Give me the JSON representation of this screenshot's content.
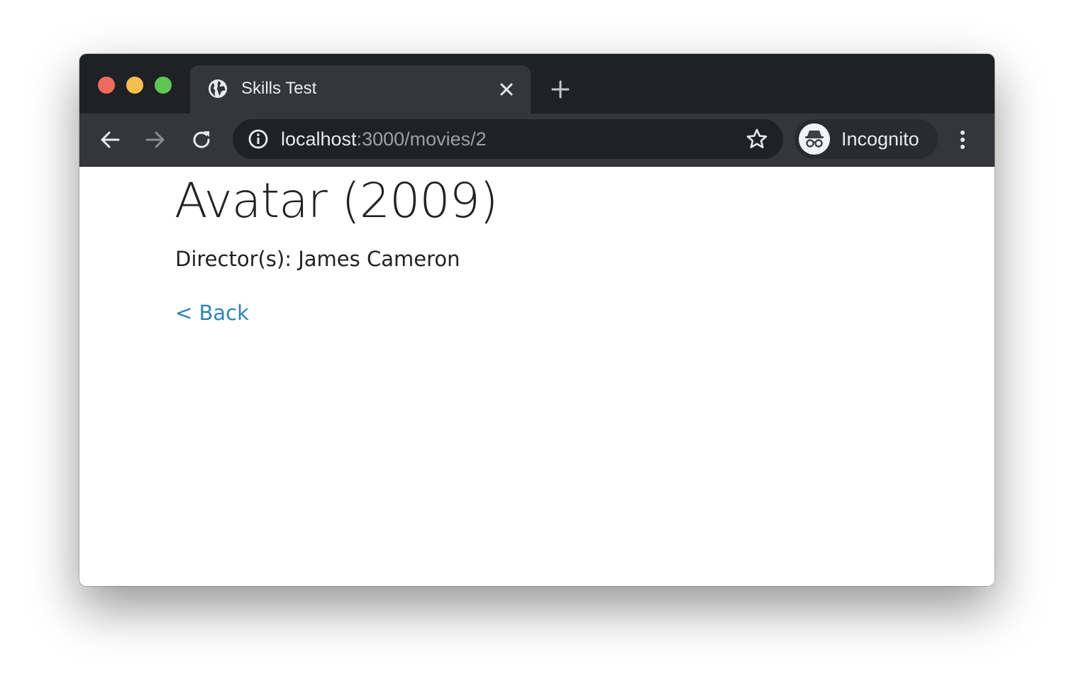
{
  "browser": {
    "tab": {
      "title": "Skills Test",
      "favicon": "globe-icon"
    },
    "omnibox": {
      "url_host": "localhost",
      "url_rest": ":3000/movies/2",
      "info_icon": "info-icon",
      "star_icon": "star-icon"
    },
    "profile": {
      "label": "Incognito",
      "icon": "incognito-icon"
    },
    "colors": {
      "frame": "#202124",
      "toolbar": "#35363a",
      "omnibox": "#202124"
    }
  },
  "page": {
    "title": "Avatar (2009)",
    "director_line": "Director(s): James Cameron",
    "back_label": "< Back",
    "link_color": "#2f84b6"
  }
}
